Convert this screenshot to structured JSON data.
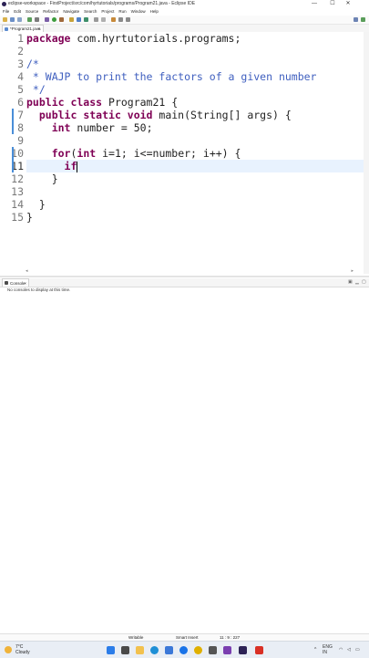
{
  "window": {
    "title": "eclipse-workspace - FirstProject/src/com/hyrtutorials/programs/Program21.java - Eclipse IDE",
    "controls": [
      "—",
      "☐",
      "✕"
    ]
  },
  "menu": [
    "File",
    "Edit",
    "Source",
    "Refactor",
    "Navigate",
    "Search",
    "Project",
    "Run",
    "Window",
    "Help"
  ],
  "editor_tab": {
    "label": "*Program21.java",
    "close": "×"
  },
  "editor": {
    "line_numbers": [
      "1",
      "2",
      "3",
      "4",
      "5",
      "6",
      "7",
      "8",
      "9",
      "10",
      "11",
      "12",
      "13",
      "14",
      "15"
    ],
    "lines": {
      "l1_kw": "package",
      "l1_rest": " com.hyrtutorials.programs;",
      "l3": "/*",
      "l4": " * WAJP to print the factors of a given number",
      "l5": " */",
      "l6_kw": "public class",
      "l6_rest": " Program21 {",
      "l7_indent": "  ",
      "l7_kw": "public static void",
      "l7_rest": " main(String[] args) {",
      "l8_indent": "    ",
      "l8_kw": "int",
      "l8_rest": " number = 50;",
      "l10_indent": "    ",
      "l10_kw": "for",
      "l10_mid": "(",
      "l10_kw2": "int",
      "l10_rest": " i=1; i<=number; i++) {",
      "l11_indent": "      ",
      "l11_kw": "if",
      "l12": "    }",
      "l14": "  }",
      "l15": "}"
    }
  },
  "console": {
    "tab_label": "Console",
    "close": "×",
    "message": "No consoles to display at this time."
  },
  "status": {
    "writable": "Writable",
    "insert_mode": "Smart Insert",
    "position": "11 : 9 : 227"
  },
  "taskbar": {
    "temperature": "7°C",
    "condition": "Cloudy",
    "tray_lang": "ENG",
    "tray_region": "IN"
  },
  "colors": {
    "keyword": "#7f0055",
    "comment": "#3f5fbf",
    "current_line": "#e8f2fe",
    "change_marker": "#4a8ed8"
  }
}
